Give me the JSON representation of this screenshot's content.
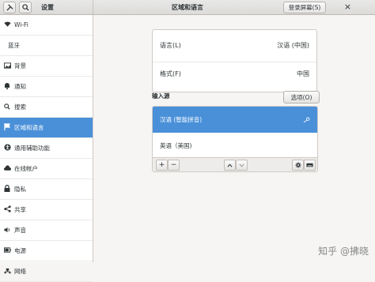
{
  "header": {
    "settings_title": "设置",
    "panel_title": "区域和语言",
    "login_screen_label": "登录屏幕(S)",
    "close_label": "×"
  },
  "sidebar": {
    "items": [
      {
        "label": "Wi-Fi",
        "icon": "wifi-icon"
      },
      {
        "label": "蓝牙",
        "icon": ""
      },
      {
        "label": "背景",
        "icon": "background-icon"
      },
      {
        "label": "通知",
        "icon": "bell-icon"
      },
      {
        "label": "搜索",
        "icon": "search-icon"
      },
      {
        "label": "区域和语言",
        "icon": "flag-icon",
        "active": true
      },
      {
        "label": "通用辅助功能",
        "icon": "accessibility-icon"
      },
      {
        "label": "在线帐户",
        "icon": "online-accounts-icon"
      },
      {
        "label": "隐私",
        "icon": "privacy-icon"
      },
      {
        "label": "共享",
        "icon": "share-icon"
      },
      {
        "label": "声音",
        "icon": "speaker-icon"
      },
      {
        "label": "电源",
        "icon": "power-icon"
      },
      {
        "label": "网络",
        "icon": "network-icon"
      }
    ]
  },
  "region": {
    "language_label": "语言(L)",
    "language_value": "汉语 (中国)",
    "format_label": "格式(F)",
    "format_value": "中国"
  },
  "input_sources": {
    "title": "输入源",
    "options_label": "选项(O)",
    "sources": [
      "汉语 (智能拼音)",
      "英语（美国)"
    ],
    "add_label": "+",
    "remove_label": "−"
  },
  "watermark": "知乎 @拂晓",
  "colors": {
    "accent": "#4a90d9"
  }
}
